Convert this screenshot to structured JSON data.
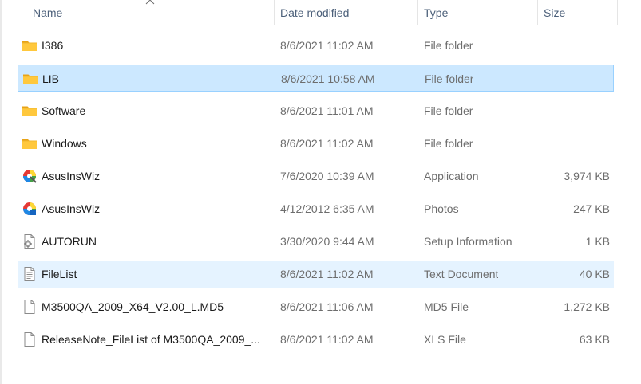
{
  "columns": {
    "name": "Name",
    "date_modified": "Date modified",
    "type": "Type",
    "size": "Size"
  },
  "rows": [
    {
      "name": "I386",
      "date": "8/6/2021 11:02 AM",
      "type": "File folder",
      "size": "",
      "icon": "folder-icon"
    },
    {
      "name": "LIB",
      "date": "8/6/2021 10:58 AM",
      "type": "File folder",
      "size": "",
      "icon": "folder-icon"
    },
    {
      "name": "Software",
      "date": "8/6/2021 11:01 AM",
      "type": "File folder",
      "size": "",
      "icon": "folder-icon"
    },
    {
      "name": "Windows",
      "date": "8/6/2021 11:02 AM",
      "type": "File folder",
      "size": "",
      "icon": "folder-icon"
    },
    {
      "name": "AsusInsWiz",
      "date": "7/6/2020 10:39 AM",
      "type": "Application",
      "size": "3,974 KB",
      "icon": "application-icon"
    },
    {
      "name": "AsusInsWiz",
      "date": "4/12/2012 6:35 AM",
      "type": "Photos",
      "size": "247 KB",
      "icon": "photos-icon"
    },
    {
      "name": "AUTORUN",
      "date": "3/30/2020 9:44 AM",
      "type": "Setup Information",
      "size": "1 KB",
      "icon": "setup-information-icon"
    },
    {
      "name": "FileList",
      "date": "8/6/2021 11:02 AM",
      "type": "Text Document",
      "size": "40 KB",
      "icon": "text-document-icon"
    },
    {
      "name": "M3500QA_2009_X64_V2.00_L.MD5",
      "date": "8/6/2021 11:06 AM",
      "type": "MD5 File",
      "size": "1,272 KB",
      "icon": "file-icon"
    },
    {
      "name": "ReleaseNote_FileList of M3500QA_2009_...",
      "date": "8/6/2021 11:02 AM",
      "type": "XLS File",
      "size": "63 KB",
      "icon": "file-icon"
    }
  ],
  "selection": {
    "selected_row": "LIB",
    "hover_row": "FileList"
  }
}
